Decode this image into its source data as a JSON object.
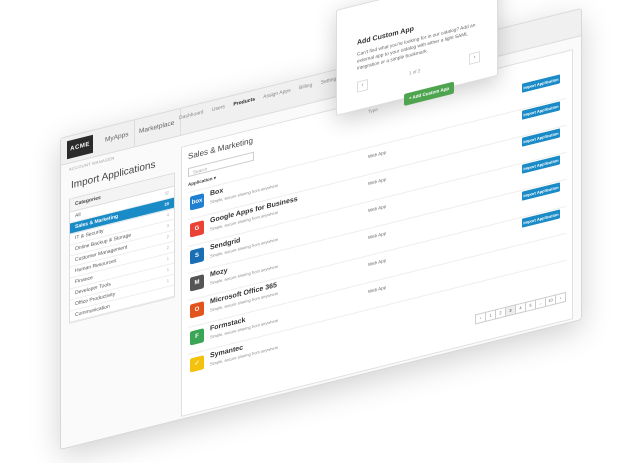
{
  "header": {
    "logo": "ACME",
    "app_tabs": [
      "MyApps",
      "Marketplace"
    ],
    "subnav": [
      "Dashboard",
      "Users",
      "Products",
      "Assign Apps",
      "Billing",
      "Settings"
    ],
    "active_subnav": "Products",
    "breadcrumb": "Account Manager"
  },
  "page_title": "Import Applications",
  "sidebar": {
    "heading": "Categories",
    "items": [
      {
        "label": "All",
        "count": "32"
      },
      {
        "label": "Sales & Marketing",
        "count": "20"
      },
      {
        "label": "IT & Security",
        "count": "4"
      },
      {
        "label": "Online Backup & Storage",
        "count": "3"
      },
      {
        "label": "Customer Management",
        "count": "2"
      },
      {
        "label": "Human Resources",
        "count": "2"
      },
      {
        "label": "Finance",
        "count": "1"
      },
      {
        "label": "Developer Tools",
        "count": "1"
      },
      {
        "label": "Office Productivity",
        "count": "1"
      },
      {
        "label": "Communication",
        "count": ""
      }
    ]
  },
  "main": {
    "section_title": "Sales & Marketing",
    "type_header": "Type",
    "search_placeholder": "Search",
    "filter_label": "Application",
    "import_label": "Import Application",
    "apps": [
      {
        "name": "Box",
        "desc": "Simple, secure sharing from anywhere",
        "type": "Web App",
        "icon": "box",
        "color": "#1f7fd1",
        "glyph": "box"
      },
      {
        "name": "Google Apps for Business",
        "desc": "Simple, secure sharing from anywhere",
        "type": "Web App",
        "icon": "google-apps",
        "color": "#ea4335",
        "glyph": "G"
      },
      {
        "name": "Sendgrid",
        "desc": "Simple, secure sharing from anywhere",
        "type": "Web App",
        "icon": "sendgrid",
        "color": "#1a6fb4",
        "glyph": "S"
      },
      {
        "name": "Mozy",
        "desc": "Simple, secure sharing from anywhere",
        "type": "Web App",
        "icon": "mozy",
        "color": "#555555",
        "glyph": "M"
      },
      {
        "name": "Microsoft Office 365",
        "desc": "Simple, secure sharing from anywhere",
        "type": "Web App",
        "icon": "office365",
        "color": "#e2541c",
        "glyph": "O"
      },
      {
        "name": "Formstack",
        "desc": "Simple, secure sharing from anywhere",
        "type": "Web App",
        "icon": "formstack",
        "color": "#3aa655",
        "glyph": "F"
      },
      {
        "name": "Symantec",
        "desc": "Simple, secure sharing from anywhere",
        "type": "",
        "icon": "symantec",
        "color": "#f4c20d",
        "glyph": "✓"
      }
    ],
    "pager": [
      "‹",
      "1",
      "2",
      "3",
      "4",
      "5",
      "…",
      "10",
      "›"
    ]
  },
  "tooltip": {
    "title": "Add Custom App",
    "body": "Can't find what you're looking for in our catalog? Add an external app to your catalog with either a light SAML integration or a simple bookmark.",
    "page": "1 of 2",
    "prev": "‹",
    "next": "›"
  },
  "add_button": "+ Add Custom App"
}
